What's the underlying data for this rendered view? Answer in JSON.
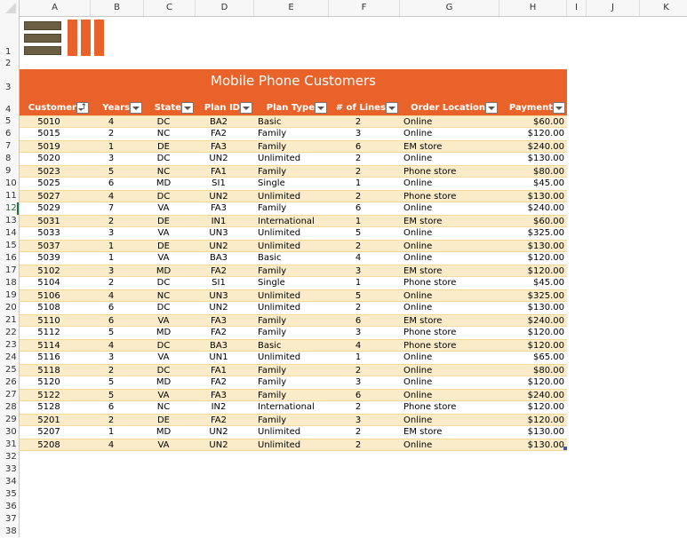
{
  "columns": [
    "A",
    "B",
    "C",
    "D",
    "E",
    "F",
    "G",
    "H",
    "I",
    "J",
    "K"
  ],
  "active_row": 12,
  "row_numbers": [
    1,
    2,
    3,
    4,
    5,
    6,
    7,
    8,
    9,
    10,
    11,
    12,
    13,
    14,
    15,
    16,
    17,
    18,
    19,
    20,
    21,
    22,
    23,
    24,
    25,
    26,
    27,
    28,
    29,
    30,
    31,
    32,
    33,
    34,
    35,
    36,
    37,
    38
  ],
  "logo": {
    "name": "logo-icon"
  },
  "colors": {
    "accent": "#e8622a",
    "band": "#fbecc9",
    "logo_dark": "#6b5e42"
  },
  "table": {
    "title": "Mobile Phone Customers",
    "headers": [
      "Customer",
      "Years",
      "State",
      "Plan ID",
      "Plan Type",
      "# of Lines",
      "Order Location",
      "Payment"
    ],
    "sorted_column": "Customer",
    "rows": [
      [
        "5010",
        "4",
        "DC",
        "BA2",
        "Basic",
        "2",
        "Online",
        "$60.00"
      ],
      [
        "5015",
        "2",
        "NC",
        "FA2",
        "Family",
        "3",
        "Online",
        "$120.00"
      ],
      [
        "5019",
        "1",
        "DE",
        "FA3",
        "Family",
        "6",
        "EM store",
        "$240.00"
      ],
      [
        "5020",
        "3",
        "DC",
        "UN2",
        "Unlimited",
        "2",
        "Online",
        "$130.00"
      ],
      [
        "5023",
        "5",
        "NC",
        "FA1",
        "Family",
        "2",
        "Phone store",
        "$80.00"
      ],
      [
        "5025",
        "6",
        "MD",
        "SI1",
        "Single",
        "1",
        "Online",
        "$45.00"
      ],
      [
        "5027",
        "4",
        "DC",
        "UN2",
        "Unlimited",
        "2",
        "Phone store",
        "$130.00"
      ],
      [
        "5029",
        "7",
        "VA",
        "FA3",
        "Family",
        "6",
        "Online",
        "$240.00"
      ],
      [
        "5031",
        "2",
        "DE",
        "IN1",
        "International",
        "1",
        "EM store",
        "$60.00"
      ],
      [
        "5033",
        "3",
        "VA",
        "UN3",
        "Unlimited",
        "5",
        "Online",
        "$325.00"
      ],
      [
        "5037",
        "1",
        "DE",
        "UN2",
        "Unlimited",
        "2",
        "Online",
        "$130.00"
      ],
      [
        "5039",
        "1",
        "VA",
        "BA3",
        "Basic",
        "4",
        "Online",
        "$120.00"
      ],
      [
        "5102",
        "3",
        "MD",
        "FA2",
        "Family",
        "3",
        "EM store",
        "$120.00"
      ],
      [
        "5104",
        "2",
        "DC",
        "SI1",
        "Single",
        "1",
        "Phone store",
        "$45.00"
      ],
      [
        "5106",
        "4",
        "NC",
        "UN3",
        "Unlimited",
        "5",
        "Online",
        "$325.00"
      ],
      [
        "5108",
        "6",
        "DC",
        "UN2",
        "Unlimited",
        "2",
        "Online",
        "$130.00"
      ],
      [
        "5110",
        "6",
        "VA",
        "FA3",
        "Family",
        "6",
        "EM store",
        "$240.00"
      ],
      [
        "5112",
        "5",
        "MD",
        "FA2",
        "Family",
        "3",
        "Phone store",
        "$120.00"
      ],
      [
        "5114",
        "4",
        "DC",
        "BA3",
        "Basic",
        "4",
        "Phone store",
        "$120.00"
      ],
      [
        "5116",
        "3",
        "VA",
        "UN1",
        "Unlimited",
        "1",
        "Online",
        "$65.00"
      ],
      [
        "5118",
        "2",
        "DC",
        "FA1",
        "Family",
        "2",
        "Online",
        "$80.00"
      ],
      [
        "5120",
        "5",
        "MD",
        "FA2",
        "Family",
        "3",
        "Online",
        "$120.00"
      ],
      [
        "5122",
        "5",
        "VA",
        "FA3",
        "Family",
        "6",
        "Online",
        "$240.00"
      ],
      [
        "5128",
        "6",
        "NC",
        "IN2",
        "International",
        "2",
        "Phone store",
        "$120.00"
      ],
      [
        "5201",
        "2",
        "DE",
        "FA2",
        "Family",
        "3",
        "Online",
        "$120.00"
      ],
      [
        "5207",
        "1",
        "MD",
        "UN2",
        "Unlimited",
        "2",
        "EM store",
        "$130.00"
      ],
      [
        "5208",
        "4",
        "VA",
        "UN2",
        "Unlimited",
        "2",
        "Online",
        "$130.00"
      ]
    ]
  }
}
